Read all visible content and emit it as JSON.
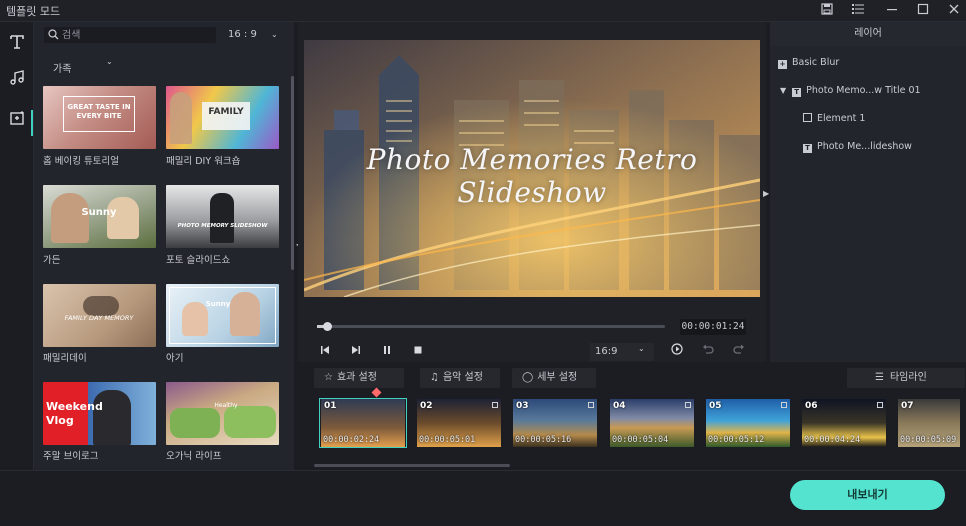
{
  "window": {
    "title": "템플릿 모드",
    "controls": [
      "save-icon",
      "list-icon",
      "minimize-icon",
      "maximize-icon",
      "close-icon"
    ]
  },
  "rail": {
    "items": [
      {
        "name": "text-tab",
        "icon": "text-icon"
      },
      {
        "name": "music-tab",
        "icon": "music-note-icon"
      },
      {
        "name": "templates-tab",
        "icon": "magic-frame-icon",
        "active": true
      }
    ]
  },
  "templates": {
    "search_placeholder": "검색",
    "ratio": "16 : 9",
    "category": "가족",
    "items": [
      {
        "label": "홈 베이킹 튜토리얼",
        "thumb_text": "GREAT TASTE IN EVERY BITE"
      },
      {
        "label": "패밀리 DIY 워크숍",
        "thumb_text": "FAMILY"
      },
      {
        "label": "가든",
        "thumb_text": "Sunny"
      },
      {
        "label": "포토 슬라이드쇼",
        "thumb_text": "PHOTO MEMORY SLIDESHOW"
      },
      {
        "label": "패밀리데이",
        "thumb_text": "FAMILY DAY MEMORY"
      },
      {
        "label": "아기",
        "thumb_text": "Sunny"
      },
      {
        "label": "주말 브이로그",
        "thumb_text": "Weekend Vlog"
      },
      {
        "label": "오가닉 라이프",
        "thumb_text": "Healthy"
      }
    ]
  },
  "preview": {
    "title_text": "Photo Memories Retro Slideshow",
    "timecode": "00:00:01:24",
    "progress": 0.03,
    "ratio": "16:9"
  },
  "layers": {
    "header": "레이어",
    "items": [
      {
        "label": "Basic Blur",
        "level": 0
      },
      {
        "label": "Photo Memo...w Title 01",
        "level": 0,
        "expanded": true
      },
      {
        "label": "Element 1",
        "level": 1
      },
      {
        "label": "Photo Me...lideshow",
        "level": 1
      }
    ]
  },
  "settings": {
    "effects": "효과 설정",
    "music": "음악 설정",
    "details": "세부 설정",
    "timeline": "타임라인"
  },
  "clips": [
    {
      "num": "01",
      "time": "00:00:02:24"
    },
    {
      "num": "02",
      "time": "00:00:05:01"
    },
    {
      "num": "03",
      "time": "00:00:05:16"
    },
    {
      "num": "04",
      "time": "00:00:05:04"
    },
    {
      "num": "05",
      "time": "00:00:05:12"
    },
    {
      "num": "06",
      "time": "00:00:04:24"
    },
    {
      "num": "07",
      "time": "00:00:05:09"
    }
  ],
  "export_label": "내보내기",
  "colors": {
    "accent": "#54e3cf",
    "selection": "#41d1bf",
    "playhead": "#ff6a6a",
    "background": "#1b1d23",
    "panel": "#23252c"
  }
}
